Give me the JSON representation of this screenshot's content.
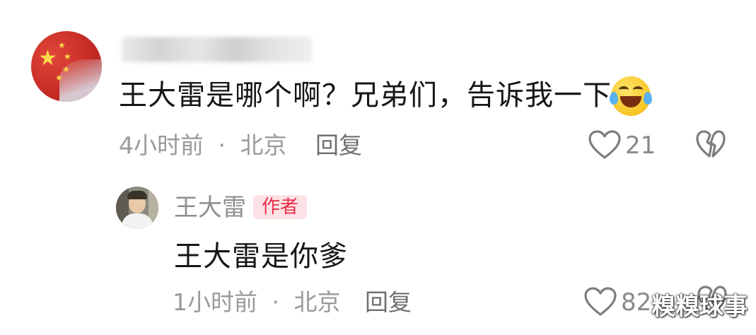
{
  "comment": {
    "text": "王大雷是哪个啊？兄弟们，告诉我一下",
    "emoji": "laughing-crying-emoji",
    "time": "4小时前",
    "separator": "·",
    "location": "北京",
    "reply_label": "回复",
    "like_count": "21"
  },
  "reply": {
    "author": "王大雷",
    "badge": "作者",
    "text": "王大雷是你爹",
    "time": "1小时前",
    "separator": "·",
    "location": "北京",
    "reply_label": "回复",
    "like_count": "82"
  },
  "watermark": "糗糗球事",
  "colors": {
    "badge_text": "#e8304a",
    "badge_bg": "#fde2e5",
    "meta_text": "#9a9a9a",
    "icon_stroke": "#7d7d7d"
  }
}
